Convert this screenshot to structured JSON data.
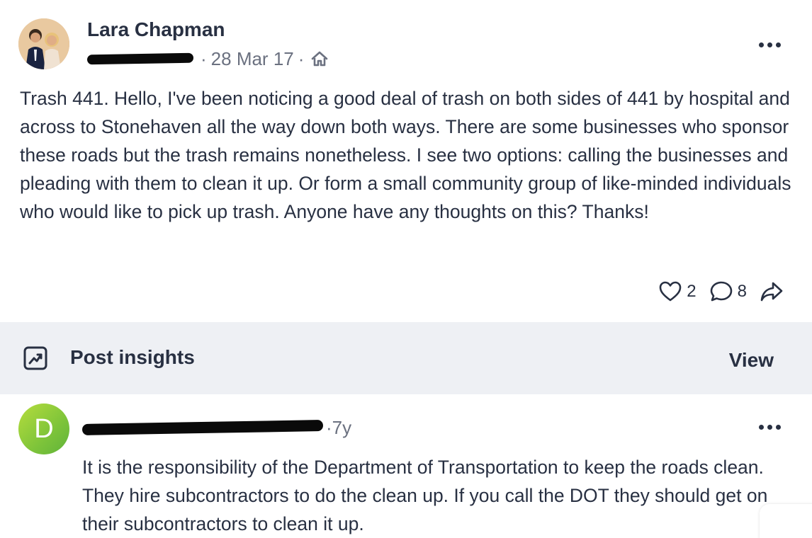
{
  "post": {
    "author": "Lara Chapman",
    "date": "28 Mar 17",
    "separator": "·",
    "body": "Trash 441. Hello, I've been noticing a good deal of trash on both sides of 441 by hospital and across to Stonehaven all the way down both ways. There are some businesses who sponsor these roads but the trash remains nonetheless. I see two options: calling the businesses and pleading with them to clean it up. Or form a small community group of like-minded individuals who would like to pick up trash. Anyone have any thoughts on this? Thanks!",
    "likes": "2",
    "comments": "8"
  },
  "insights": {
    "label": "Post insights",
    "view_label": "View"
  },
  "comment": {
    "avatar_letter": "D",
    "age": "7y",
    "separator": "·",
    "text": "It is the responsibility of the Department of Transportation to keep the roads clean. They hire subcontractors to do the clean up. If you call the DOT they should get on their subcontractors to clean it up."
  },
  "icons": {
    "home": "home-icon",
    "more": "more-horizontal-icon",
    "like": "heart-icon",
    "comment": "speech-bubble-icon",
    "share": "share-arrow-icon",
    "insights": "trend-chart-icon"
  },
  "colors": {
    "text": "#283042",
    "muted": "#6b7180",
    "insights_bg": "#eef0f4",
    "comment_avatar": "#7ec43a"
  }
}
